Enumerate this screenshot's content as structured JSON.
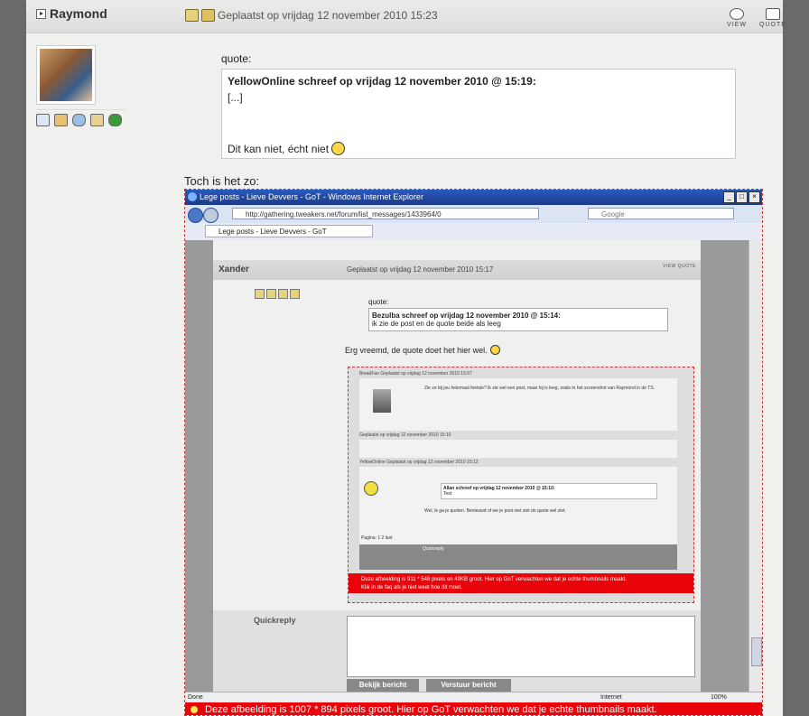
{
  "post": {
    "author": "Raymond",
    "posted_text": "Geplaatst op vrijdag 12 november 2010 15:23",
    "actions": {
      "view": "VIEW",
      "quote": "QUOTE"
    },
    "quote_label": "quote:",
    "quote_author": "YellowOnline schreef op vrijdag 12 november 2010 @ 15:19:",
    "quote_ellipsis": "[...]",
    "quote_last": "Dit kan niet, écht niet",
    "body_text": "Toch is het zo:"
  },
  "screenshot": {
    "window_title": "Lege posts - Lieve Devvers - GoT - Windows Internet Explorer",
    "url": "http://gathering.tweakers.net/forum/list_messages/1433964/0",
    "search_placeholder": "Google",
    "tab_title": "Lege posts - Lieve Devvers - GoT",
    "status_done": "Done",
    "status_zone": "Internet",
    "status_zoom": "100%",
    "inner_author": "Xander",
    "inner_posted": "Geplaatst op vrijdag 12 november 2010 15:17",
    "inner_actions": "VIEW  QUOTE",
    "inner_quote_label": "quote:",
    "inner_quote_author": "Bezulba schreef op vrijdag 12 november 2010 @ 15:14:",
    "inner_quote_text": "ik zie de post en de quote beide als leeg",
    "inner_body": "Erg vreemd, de quote doet het hier wel.",
    "nested_rows": [
      "BreadFan    Geplaatst op vrijdag 12 november 2010 15:07",
      "Geplaatst op vrijdag 12 november 2010 15:10",
      "YellowOnline    Geplaatst op vrijdag 12 november 2010 15:12"
    ],
    "nested_text_1": "Zie ze bij jou helemaal foetsie? Ik zie wel een post, maar hij is leeg, zoals in het screenshot van Raymond in de TS.",
    "nested_quote": "Allan schreef op vrijdag 12 november 2010 @ 15:10:",
    "nested_quote_text": "Test",
    "nested_text_2": "Wel, ik ga je quoten. Benieuwd of we je post niet ziet de quote wel ziet.",
    "nested_pages": "Pagina: 1 2 last",
    "nested_quickreply": "Quickreply",
    "nested_warn_1": "Deze afbeelding is 911 * 548 pixels en 49KB groot. Hier op GoT verwachten we dat je echte thumbnails maakt.",
    "nested_warn_2": "Klik in de faq als je niet weet hoe dit moet.",
    "quickreply_label": "Quickreply",
    "btn_preview": "Bekijk bericht",
    "btn_send": "Verstuur bericht",
    "outer_warn": "Deze afbeelding is 1007 * 894 pixels groot. Hier op GoT verwachten we dat je echte thumbnails maakt."
  }
}
